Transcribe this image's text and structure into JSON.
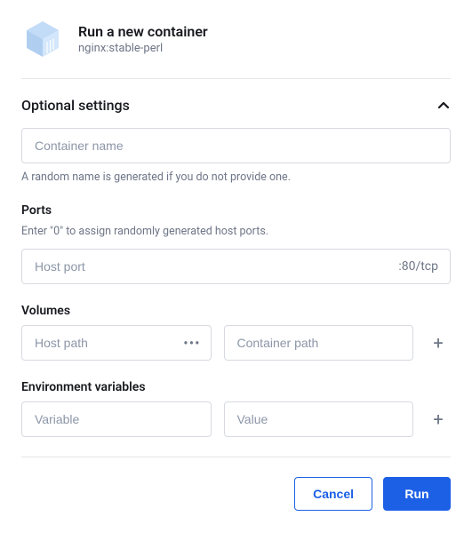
{
  "header": {
    "title": "Run a new container",
    "image": "nginx:stable-perl"
  },
  "optional": {
    "heading": "Optional settings",
    "container_name": {
      "placeholder": "Container name",
      "helper": "A random name is generated if you do not provide one."
    },
    "ports": {
      "label": "Ports",
      "helper": "Enter \"0\" to assign randomly generated host ports.",
      "host_placeholder": "Host port",
      "mapping": ":80/tcp"
    },
    "volumes": {
      "label": "Volumes",
      "host_placeholder": "Host path",
      "container_placeholder": "Container path"
    },
    "env": {
      "label": "Environment variables",
      "variable_placeholder": "Variable",
      "value_placeholder": "Value"
    }
  },
  "footer": {
    "cancel": "Cancel",
    "run": "Run"
  },
  "icons": {
    "add": "+",
    "dots": "•••",
    "chevron_up": "⌃"
  }
}
